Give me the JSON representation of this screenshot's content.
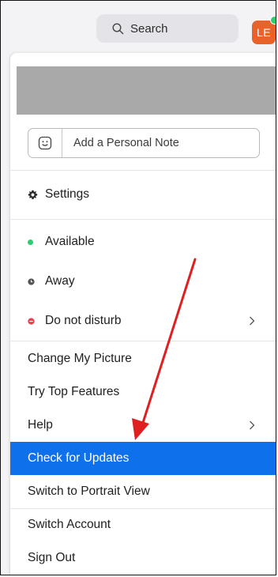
{
  "topbar": {
    "search_label": "Search",
    "avatar_initials": "LE"
  },
  "colors": {
    "accent": "#0e71eb",
    "avatar": "#e8622a",
    "available": "#2ecc71",
    "away": "#555555",
    "dnd": "#e0424f",
    "annotation_arrow": "#e02020"
  },
  "menu": {
    "note_placeholder": "Add a Personal Note",
    "settings": "Settings",
    "available": "Available",
    "away": "Away",
    "do_not_disturb": "Do not disturb",
    "change_picture": "Change My Picture",
    "try_features": "Try Top Features",
    "help": "Help",
    "check_updates": "Check for Updates",
    "portrait_view": "Switch to Portrait View",
    "switch_account": "Switch Account",
    "sign_out": "Sign Out"
  }
}
